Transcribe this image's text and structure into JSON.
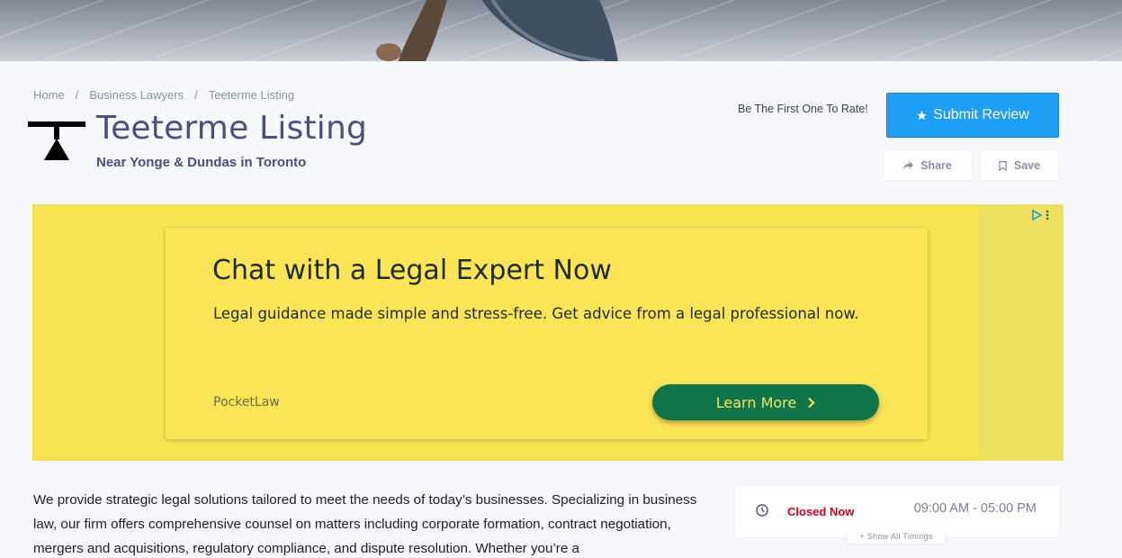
{
  "breadcrumb": {
    "items": [
      "Home",
      "Business Lawyers",
      "Teeterme Listing"
    ],
    "separator": "/"
  },
  "listing": {
    "title": "Teeterme Listing",
    "subtitle": "Near Yonge & Dundas in Toronto"
  },
  "actions": {
    "rate_prompt": "Be The First One To Rate!",
    "submit_review": "Submit Review",
    "share": "Share",
    "save": "Save"
  },
  "ad": {
    "headline": "Chat with a Legal Expert Now",
    "body": "Legal guidance made simple and stress-free. Get advice from a legal professional now.",
    "brand": "PocketLaw",
    "cta": "Learn More",
    "colors": {
      "background": "#f7e450",
      "cta_background": "#10744a"
    }
  },
  "description": "We provide strategic legal solutions tailored to meet the needs of today’s businesses. Specializing in business law, our firm offers comprehensive counsel on matters including corporate formation, contract negotiation, mergers and acquisitions, regulatory compliance, and dispute resolution. Whether you’re a",
  "hours": {
    "status": "Closed Now",
    "time_range": "09:00 AM - 05:00 PM",
    "show_all": "Show All Timings"
  },
  "colors": {
    "accent": "#1e9ef4",
    "title": "#4a4f7d",
    "closed": "#d0021b"
  },
  "icons": [
    "star-icon",
    "share-icon",
    "bookmark-icon",
    "clock-icon",
    "chevron-right-icon",
    "ad-choices-icon",
    "more-vert-icon",
    "plus-icon"
  ]
}
